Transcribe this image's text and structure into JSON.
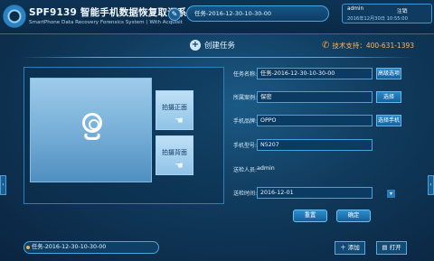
{
  "header": {
    "title": "SPF9139 智能手机数据恢复取证系统",
    "subtitle": "SmartPhone Data Recovery Forensics System ( With Acquisit",
    "current_tab": "任务-2016-12-30-10-30-00"
  },
  "user": {
    "name": "admin",
    "logout_label": "注销",
    "datetime": "2016年12月30日 10:55:00"
  },
  "create": {
    "label": "创建任务",
    "support": "技术支持：400-631-1393"
  },
  "capture": {
    "front_label": "拍摄正面",
    "back_label": "拍摄背面"
  },
  "form": {
    "task_name_label": "任务名称:",
    "task_name_value": "任务-2016-12-30-10-30-00",
    "task_name_btn": "高级选项",
    "case_label": "所属案例:",
    "case_value": "保密",
    "case_btn": "选择",
    "brand_label": "手机品牌:",
    "brand_value": "OPPO",
    "brand_btn": "选择手机",
    "model_label": "手机型号:",
    "model_value": "N5207",
    "sender_label": "送检人员:",
    "sender_value": "admin",
    "time_label": "送检时间:",
    "time_value": "2016-12-01"
  },
  "actions": {
    "reset": "重置",
    "confirm": "确定"
  },
  "bottom": {
    "task_tab": "任务-2016-12-30-10-30-00",
    "add": "添加",
    "open": "打开"
  }
}
